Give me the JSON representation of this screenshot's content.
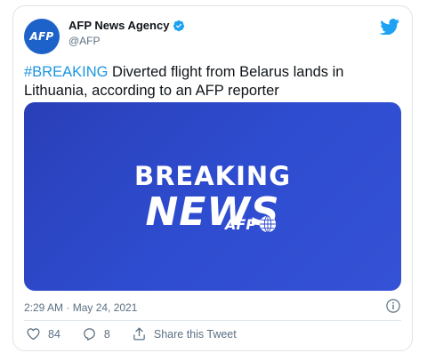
{
  "tweet": {
    "author": {
      "avatar_text": "AFP",
      "display_name": "AFP News Agency",
      "handle": "@AFP",
      "verified": true
    },
    "text": {
      "hashtag": "#BREAKING",
      "body": " Diverted flight from Belarus lands in Lithuania, according to an AFP reporter"
    },
    "media": {
      "line1": "BREAKING",
      "line2": "NEWS",
      "logo": "AFP"
    },
    "timestamp": "2:29 AM · May 24, 2021",
    "actions": {
      "likes": "84",
      "replies": "8",
      "share_label": "Share this Tweet"
    }
  },
  "colors": {
    "accent": "#1da1f2",
    "hashtag": "#1b95e0",
    "avatar_bg": "#1d62c9",
    "media_bg": "#2e4ccf",
    "muted_text": "#5b7083",
    "primary_text": "#0f1419"
  },
  "icons": [
    "verified-icon",
    "twitter-bird-icon",
    "info-icon",
    "heart-icon",
    "reply-icon",
    "share-icon",
    "globe-icon"
  ]
}
